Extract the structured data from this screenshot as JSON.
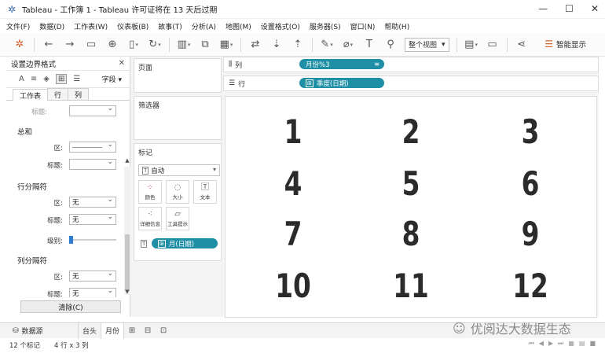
{
  "window": {
    "title": "Tableau - 工作簿 1 - Tableau 许可证将在 13 天后过期",
    "controls": {
      "minimize": "—",
      "maximize": "☐",
      "close": "✕"
    }
  },
  "menu": [
    "文件(F)",
    "数据(D)",
    "工作表(W)",
    "仪表板(B)",
    "故事(T)",
    "分析(A)",
    "地图(M)",
    "设置格式(O)",
    "服务器(S)",
    "窗口(N)",
    "帮助(H)"
  ],
  "toolbar": {
    "fit_select": "整个视图",
    "smart_display": "智能显示"
  },
  "format_pane": {
    "title": "设置边界格式",
    "field_button": "字段",
    "tabs": [
      "工作表",
      "行",
      "列"
    ],
    "cut_label": "标题:",
    "total_section": "总和",
    "area_label": "区:",
    "title_label": "标题:",
    "row_band_section": "行分隔符",
    "row_area_value": "无",
    "row_title_value": "无",
    "level_label": "级别:",
    "col_band_section": "列分隔符",
    "col_area_value": "无",
    "col_title_value": "无",
    "clear_button": "清除(C)"
  },
  "cards": {
    "pages": "页面",
    "filters": "筛选器",
    "marks": "标记",
    "marks_type": "自动",
    "mark_buttons": [
      "颜色",
      "大小",
      "文本",
      "详细信息",
      "工具提示"
    ],
    "marks_pill": "月(日期)"
  },
  "shelves": {
    "columns_label": "列",
    "columns_pill": "月份%3",
    "rows_label": "行",
    "rows_pill": "季度(日期)"
  },
  "view": {
    "cells": [
      "1",
      "2",
      "3",
      "4",
      "5",
      "6",
      "7",
      "8",
      "9",
      "10",
      "11",
      "12"
    ]
  },
  "tabs": {
    "datasource": "数据源",
    "sheets": [
      "台头",
      "月份"
    ]
  },
  "watermark": "优阅达大数据生态",
  "status": {
    "marks": "12 个标记",
    "dims": "4 行 x 3 列"
  }
}
